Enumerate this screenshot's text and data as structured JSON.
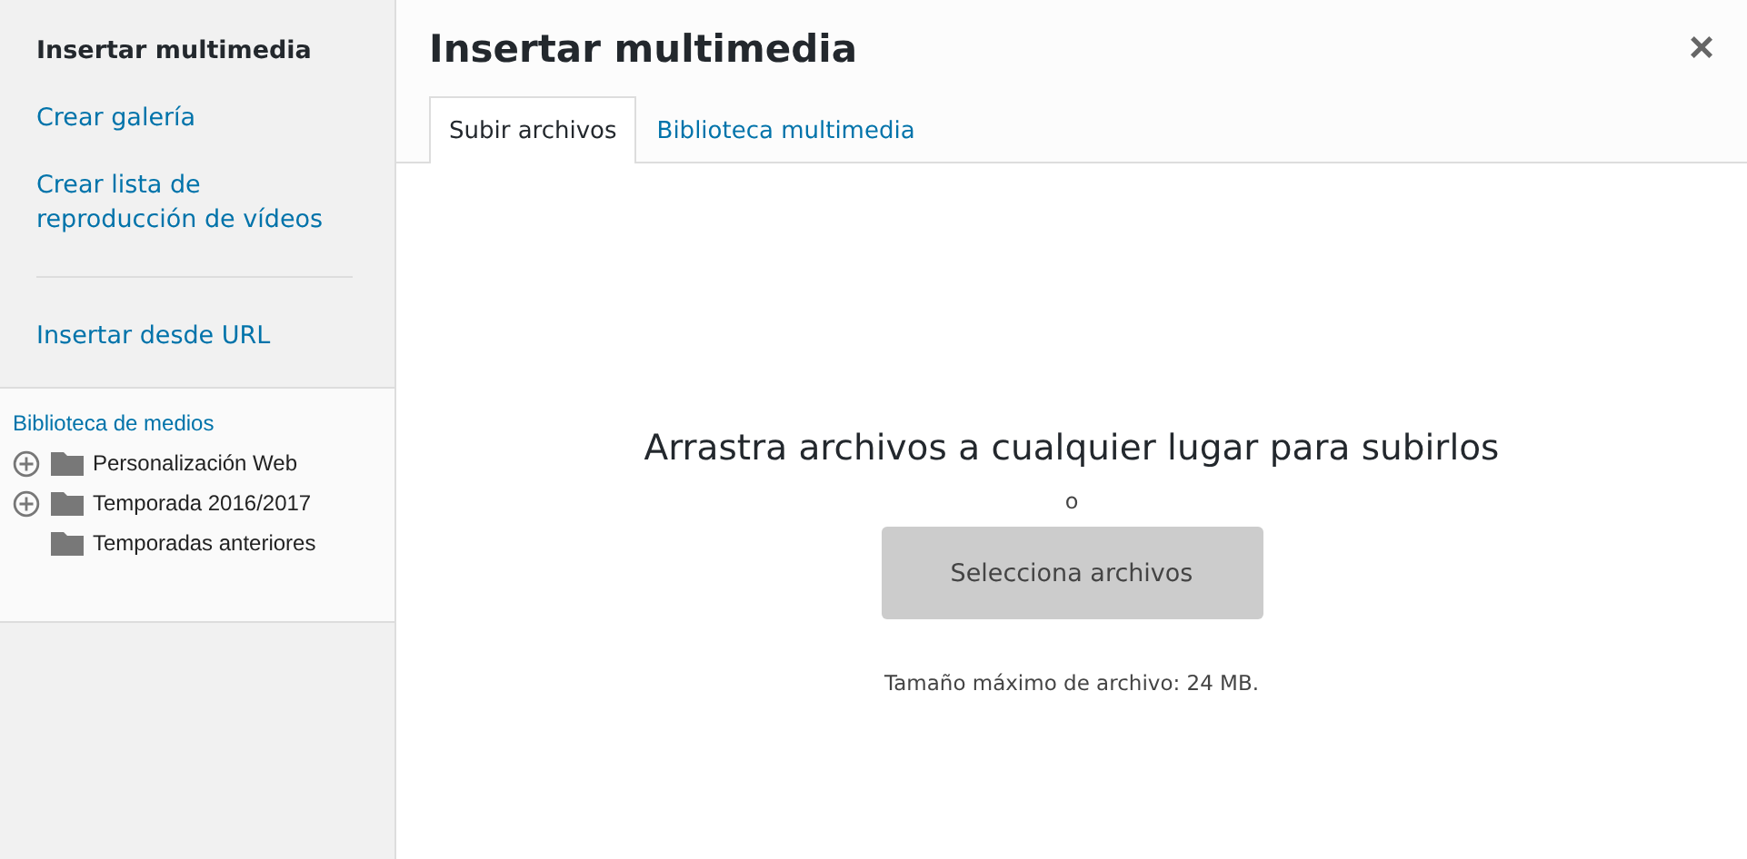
{
  "sidebar": {
    "menu": [
      {
        "label": "Insertar multimedia",
        "selected": true
      },
      {
        "label": "Crear galería",
        "selected": false
      },
      {
        "label": "Crear lista de reproducción de vídeos",
        "selected": false
      }
    ],
    "extra": [
      {
        "label": "Insertar desde URL",
        "selected": false
      }
    ],
    "library": {
      "title": "Biblioteca de medios",
      "folders": [
        {
          "name": "Personalización Web",
          "expandable": true
        },
        {
          "name": "Temporada 2016/2017",
          "expandable": true
        },
        {
          "name": "Temporadas anteriores",
          "expandable": false
        }
      ]
    }
  },
  "header": {
    "title": "Insertar multimedia",
    "close": "×"
  },
  "tabs": [
    {
      "label": "Subir archivos",
      "selected": true
    },
    {
      "label": "Biblioteca multimedia",
      "selected": false
    }
  ],
  "uploader": {
    "instructions": "Arrastra archivos a cualquier lugar para subirlos",
    "or": "o",
    "button": "Selecciona archivos",
    "max_size": "Tamaño máximo de archivo: 24 MB."
  }
}
